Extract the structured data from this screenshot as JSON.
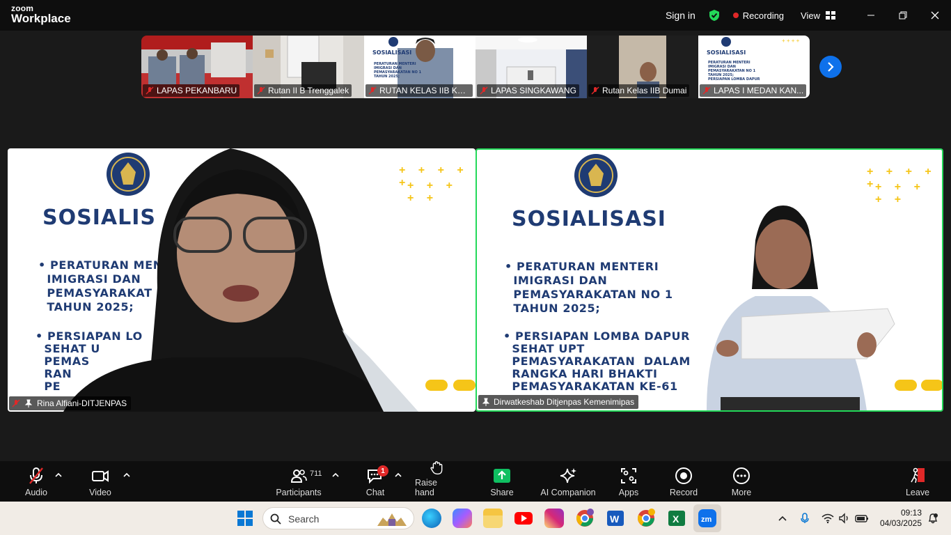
{
  "app": {
    "brand_top": "zoom",
    "brand_bottom": "Workplace"
  },
  "topbar": {
    "signin": "Sign in",
    "recording": "Recording",
    "view": "View"
  },
  "thumbnails": [
    {
      "label": "LAPAS PEKANBARU"
    },
    {
      "label": "Rutan II B Trenggalek"
    },
    {
      "label": "RUTAN KELAS IIB KU..."
    },
    {
      "label": "LAPAS SINGKAWANG"
    },
    {
      "label": "Rutan Kelas IIB Dumai"
    },
    {
      "label": "LAPAS I MEDAN KAN..."
    }
  ],
  "thumb_slide": {
    "title": "SOSIALISASI",
    "line1": "PERATURAN MENTERI",
    "line2": "IMIGRASI DAN",
    "line3": "PEMASYARAKATAN NO 1",
    "line4": "TAHUN 2025;",
    "line5": "PERSIAPAN LOMBA DAPUR"
  },
  "tiles": {
    "left": {
      "name": "Rina Alfiani-DITJENPAS",
      "slide_title": "SOSIALIS",
      "items": [
        "• PERATURAN MENT",
        "  IMIGRASI DAN",
        "  PEMASYARAKAT",
        "  TAHUN 2025;",
        "• PERSIAPAN LO",
        "  SEHAT U",
        "  PEMAS",
        "  RAN",
        "  PE"
      ]
    },
    "right": {
      "name": "Dirwatkeshab Ditjenpas Kemenimipas",
      "slide_title": "SOSIALISASI",
      "items": [
        "• PERATURAN MENTERI",
        "  IMIGRASI DAN",
        "  PEMASYARAKATAN NO 1",
        "  TAHUN 2025;",
        "• PERSIAPAN LOMBA DAPUR",
        "  SEHAT UPT",
        "  PEMASYARAKATAN  DALAM",
        "  RANGKA HARI BHAKTI",
        "  PEMASYARAKATAN KE-61"
      ]
    }
  },
  "toolbar": {
    "audio": "Audio",
    "video": "Video",
    "participants": "Participants",
    "participants_count": "711",
    "chat": "Chat",
    "chat_badge": "1",
    "raise_hand": "Raise hand",
    "share": "Share",
    "ai_companion": "AI Companion",
    "apps": "Apps",
    "record": "Record",
    "more": "More",
    "leave": "Leave"
  },
  "taskbar": {
    "search_placeholder": "Search",
    "time": "09:13",
    "date": "04/03/2025"
  },
  "colors": {
    "accent_green": "#23d959",
    "rec_red": "#e02828",
    "share_green": "#0fbf61",
    "zoom_blue": "#0e71eb"
  }
}
